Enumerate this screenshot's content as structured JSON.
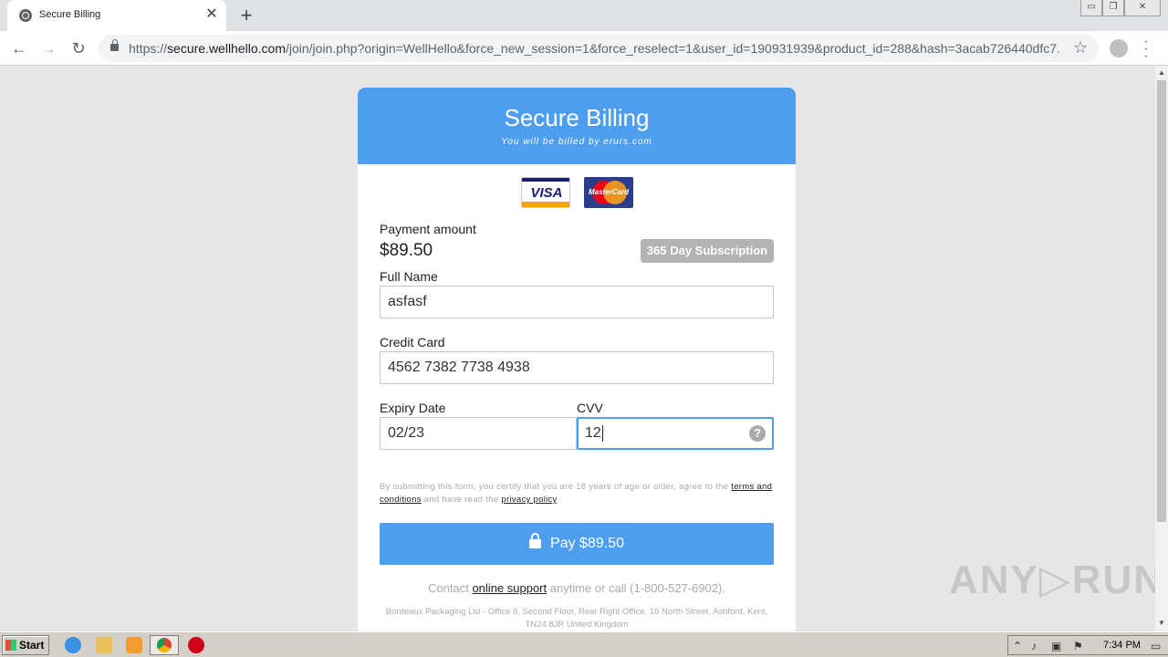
{
  "browser": {
    "tab_title": "Secure Billing",
    "tab_close": "✕",
    "new_tab": "+",
    "url_scheme": "https://",
    "url_host": "secure.wellhello.com",
    "url_path": "/join/join.php?origin=WellHello&force_new_session=1&force_reselect=1&user_id=190931939&product_id=288&hash=3acab726440dfc7...",
    "window_controls": [
      "▭",
      "❐",
      "✕"
    ]
  },
  "page": {
    "header_title": "Secure Billing",
    "header_subtitle": "You will be billed by erurs.com",
    "card_logos": [
      "VISA",
      "MasterCard"
    ],
    "payment_amount_label": "Payment amount",
    "payment_amount": "$89.50",
    "subscription_badge": "365 Day Subscription",
    "full_name_label": "Full Name",
    "full_name_value": "asfasf",
    "credit_card_label": "Credit Card",
    "credit_card_value": "4562 7382 7738 4938",
    "expiry_label": "Expiry Date",
    "expiry_value": "02/23",
    "cvv_label": "CVV",
    "cvv_value": "12",
    "cvv_help": "?",
    "legal_text_1": "By submitting this form, you certify that you are 18 years of age or older, agree to the",
    "legal_link_terms": "terms and conditions",
    "legal_text_2": "and have read the",
    "legal_link_privacy": "privacy policy",
    "legal_text_3": ".",
    "pay_button": "Pay $89.50",
    "contact_prefix": "Contact",
    "contact_link": "online support",
    "contact_suffix": "anytime or call (1-800-527-6902).",
    "address": "Bordeaux Packaging Ltd - Office 8, Second Floor, Rear Right Office, 18 North Street, Ashford, Kent, TN24 8JR United Kingdom"
  },
  "watermark": "ANY▷RUN",
  "taskbar": {
    "start_label": "Start",
    "clock": "7:34 PM"
  },
  "colors": {
    "accent": "#4d9eef",
    "badge": "#b3b3b3"
  }
}
